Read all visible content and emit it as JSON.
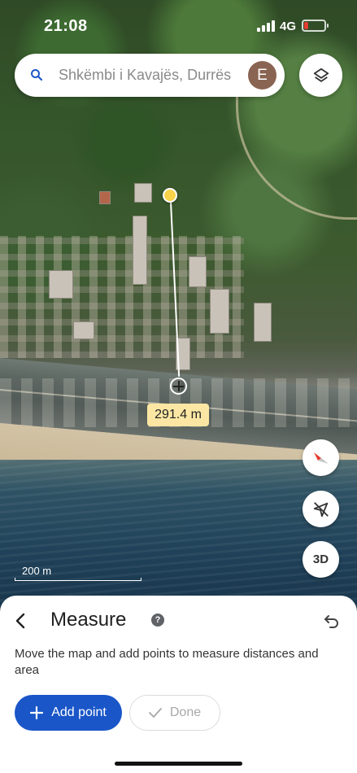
{
  "status_bar": {
    "time": "21:08",
    "network": "4G",
    "battery_level": 0.2,
    "battery_color": "#e53b30"
  },
  "search": {
    "text": "Shkëmbi i Kavajës, Durrës",
    "avatar_letter": "E",
    "avatar_color": "#8a6452"
  },
  "map": {
    "distance_label": "291.4 m",
    "scale_label": "200 m",
    "controls": {
      "three_d_label": "3D"
    },
    "icons": [
      "search-icon",
      "layers-icon",
      "compass-icon",
      "location-off-icon"
    ]
  },
  "sheet": {
    "title": "Measure",
    "help": "?",
    "description": "Move the map and add points to measure distances and area",
    "add_point_label": "Add point",
    "done_label": "Done",
    "accent_color": "#1a56c8",
    "icons": [
      "back-arrow-icon",
      "help-icon",
      "undo-icon",
      "plus-icon",
      "checkmark-icon"
    ]
  }
}
